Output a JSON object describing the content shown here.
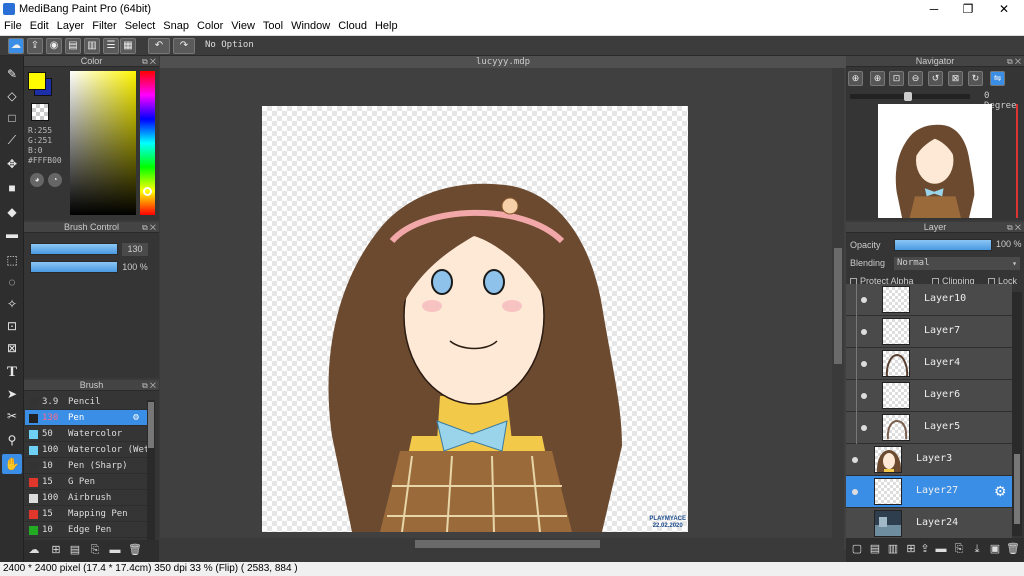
{
  "window": {
    "title": "MediBang Paint Pro (64bit)",
    "minimize": "─",
    "maximize": "❐",
    "close": "✕"
  },
  "menu": [
    "File",
    "Edit",
    "Layer",
    "Filter",
    "Select",
    "Snap",
    "Color",
    "View",
    "Tool",
    "Window",
    "Cloud",
    "Help"
  ],
  "toolbar": {
    "option_text": "No Option",
    "undo": "↶",
    "redo": "↷"
  },
  "color_panel": {
    "title": "Color",
    "r": "R:255",
    "g": "G:251",
    "b": "B:0",
    "hex": "#FFFB00",
    "foreground": "#FFFB00",
    "background": "#1C2FA8"
  },
  "brush_control": {
    "title": "Brush Control",
    "size": "130",
    "opacity": "100 %"
  },
  "brush_panel": {
    "title": "Brush",
    "items": [
      {
        "size": "3.9",
        "name": "Pencil",
        "color": "#333333"
      },
      {
        "size": "130",
        "name": "Pen",
        "color": "#222222"
      },
      {
        "size": "50",
        "name": "Watercolor",
        "color": "#6fd0f5"
      },
      {
        "size": "100",
        "name": "Watercolor (Wet)",
        "color": "#6fd0f5"
      },
      {
        "size": "10",
        "name": "Pen (Sharp)",
        "color": "#333333"
      },
      {
        "size": "15",
        "name": "G Pen",
        "color": "#e0362b"
      },
      {
        "size": "100",
        "name": "Airbrush",
        "color": "#dddddd"
      },
      {
        "size": "15",
        "name": "Mapping Pen",
        "color": "#e0362b"
      },
      {
        "size": "10",
        "name": "Edge Pen",
        "color": "#22aa22"
      }
    ]
  },
  "document": {
    "tab": "lucyyy.mdp",
    "watermark_name": "PLAYMYACE",
    "watermark_date": "22.02.2020"
  },
  "navigator": {
    "title": "Navigator",
    "degree": "0 Degree"
  },
  "layer_panel": {
    "title": "Layer",
    "opacity_label": "Opacity",
    "opacity_value": "100 %",
    "blending_label": "Blending",
    "blending_value": "Normal",
    "protect_alpha": "Protect Alpha",
    "clipping": "Clipping",
    "lock": "Lock",
    "layers": [
      {
        "name": "Layer10"
      },
      {
        "name": "Layer7"
      },
      {
        "name": "Layer4"
      },
      {
        "name": "Layer6"
      },
      {
        "name": "Layer5"
      },
      {
        "name": "Layer3"
      },
      {
        "name": "Layer27"
      },
      {
        "name": "Layer24"
      }
    ]
  },
  "status": {
    "text": "2400 * 2400 pixel  (17.4 * 17.4cm)  350 dpi  33 % (Flip)  ( 2583, 884 )"
  }
}
